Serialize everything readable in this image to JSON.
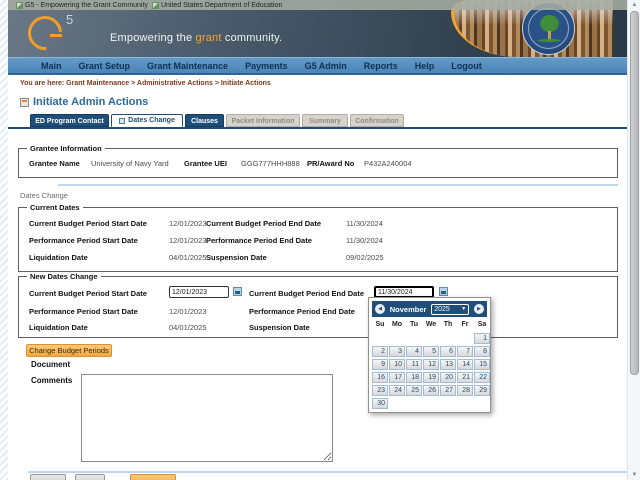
{
  "browser_titles": [
    "G5 - Empowering the Grant Community",
    "United States Department of Education"
  ],
  "banner": {
    "logo_five": "5",
    "tagline_pre": "Empowering the ",
    "tagline_accent": "grant",
    "tagline_post": " community."
  },
  "nav": {
    "items": [
      "Main",
      "Grant Setup",
      "Grant Maintenance",
      "Payments",
      "G5 Admin",
      "Reports",
      "Help",
      "Logout"
    ]
  },
  "breadcrumb": {
    "prefix": "You are here:",
    "path": "Grant Maintenance > Administrative Actions > Initiate Actions"
  },
  "page_title": "Initiate Admin Actions",
  "tabs": [
    {
      "label": "ED Program Contact",
      "state": "inactive"
    },
    {
      "label": "Dates Change",
      "state": "current"
    },
    {
      "label": "Clauses",
      "state": "inactive"
    },
    {
      "label": "Packet Information",
      "state": "disabled"
    },
    {
      "label": "Summary",
      "state": "disabled"
    },
    {
      "label": "Confirmation",
      "state": "disabled"
    }
  ],
  "grantee_info": {
    "legend": "Grantee Information",
    "fields": [
      {
        "label": "Grantee Name",
        "value": "University of Navy Yard"
      },
      {
        "label": "Grantee UEI",
        "value": "GGG777HHH888"
      },
      {
        "label": "PR/Award No",
        "value": "P432A240004"
      }
    ]
  },
  "dates_change_section_label": "Dates Change",
  "current_dates": {
    "legend": "Current Dates",
    "rows": [
      {
        "l1": "Current Budget Period Start Date",
        "v1": "12/01/2023",
        "l2": "Current Budget Period End Date",
        "v2": "11/30/2024"
      },
      {
        "l1": "Performance Period Start Date",
        "v1": "12/01/2023",
        "l2": "Performance Period End Date",
        "v2": "11/30/2024"
      },
      {
        "l1": "Liquidation Date",
        "v1": "04/01/2025",
        "l2": "Suspension Date",
        "v2": "09/02/2025"
      }
    ]
  },
  "new_dates": {
    "legend": "New Dates Change",
    "editable_row": {
      "l1": "Current Budget Period Start Date",
      "v1": "12/01/2023",
      "l2": "Current Budget Period End Date",
      "v2": "11/30/2024"
    },
    "static_rows": [
      {
        "l1": "Performance Period Start Date",
        "v1": "12/01/2023",
        "l2": "Performance Period End Date"
      },
      {
        "l1": "Liquidation Date",
        "v1": "04/01/2025",
        "l2": "Suspension Date"
      }
    ]
  },
  "calendar": {
    "month": "November",
    "year": "2025",
    "day_headers": [
      "Su",
      "Mo",
      "Tu",
      "We",
      "Th",
      "Fr",
      "Sa"
    ],
    "weeks": [
      [
        "",
        "",
        "",
        "",
        "",
        "",
        "1"
      ],
      [
        "2",
        "3",
        "4",
        "5",
        "6",
        "7",
        "8"
      ],
      [
        "9",
        "10",
        "11",
        "12",
        "13",
        "14",
        "15"
      ],
      [
        "16",
        "17",
        "18",
        "19",
        "20",
        "21",
        "22"
      ],
      [
        "23",
        "24",
        "25",
        "26",
        "27",
        "28",
        "29"
      ],
      [
        "30",
        "",
        "",
        "",
        "",
        "",
        ""
      ]
    ]
  },
  "buttons": {
    "change_budget_periods": "Change Budget Periods"
  },
  "document_label": "Document",
  "comments": {
    "label": "Comments",
    "value": ""
  },
  "icons": {
    "prev_arrow": "◀",
    "next_arrow": "▶",
    "dropdown_chevron": "▼",
    "scroll_up": "▲",
    "scroll_down": "▼"
  },
  "colors": {
    "navy": "#1f4e79",
    "nav_blue": "#4b84b6",
    "accent_orange": "#f6a62c",
    "breadcrumb_brown": "#7c3a1a",
    "title_blue": "#2e6a9e"
  }
}
